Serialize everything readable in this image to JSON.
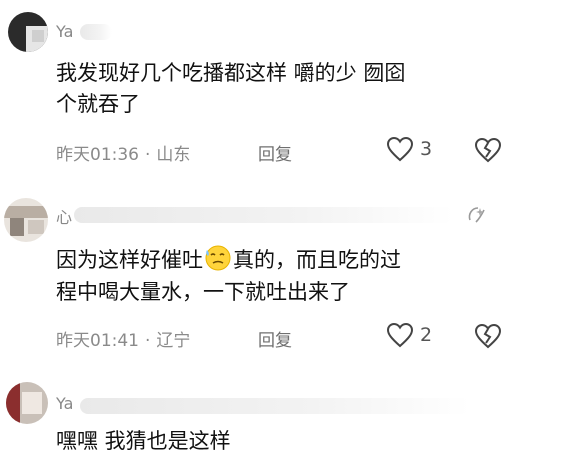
{
  "comments": [
    {
      "username": "Ya",
      "text_lines": [
        "我发现好几个吃播都这样 嚼的少 囫囵",
        "个就吞了"
      ],
      "time": "昨天01:36",
      "location": "山东",
      "reply_label": "回复",
      "like_count": "3"
    },
    {
      "username": "心",
      "text_line1_before": "因为这样好催吐",
      "text_line1_after": "真的，而且吃的过",
      "text_line2": "程中喝大量水，一下就吐出来了",
      "time": "昨天01:41",
      "location": "辽宁",
      "reply_label": "回复",
      "like_count": "2"
    },
    {
      "username": "Ya",
      "text_partial": "嘿嘿 我猜也是这样"
    }
  ],
  "icons": {
    "like": "heart-outline-icon",
    "dislike": "broken-heart-icon",
    "emoji": "sweat-emoji-icon",
    "badge": "sparkle-badge-icon"
  }
}
